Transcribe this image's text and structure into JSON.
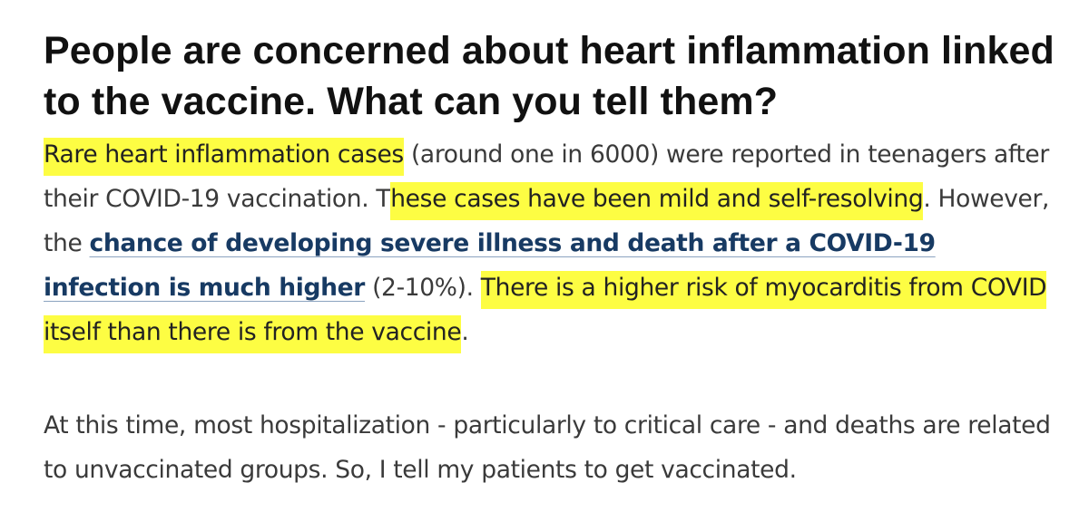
{
  "article": {
    "heading": "People are concerned about heart inflammation linked to the vaccine. What can you tell them?",
    "paragraph1": {
      "highlight1": "Rare heart inflammation cases",
      "text1": " (around one in 6000) were reported in teenagers after their COVID-19 vaccination. T",
      "highlight2": "hese cases have been mild and self-resolving",
      "text2": ". However, the ",
      "link_text": "chance of developing severe illness and death after a COVID-19 infection is much higher",
      "text3": " (2-10%). ",
      "highlight3": "There is a higher risk of myocarditis from COVID itself than there is from the vaccine",
      "text4": "."
    },
    "paragraph2": "At this time, most hospitalization - particularly to critical care - and deaths are related to unvaccinated groups. So, I tell my patients to get vaccinated.",
    "highlight_color": "#fdfd43",
    "link_color": "#173a63"
  }
}
